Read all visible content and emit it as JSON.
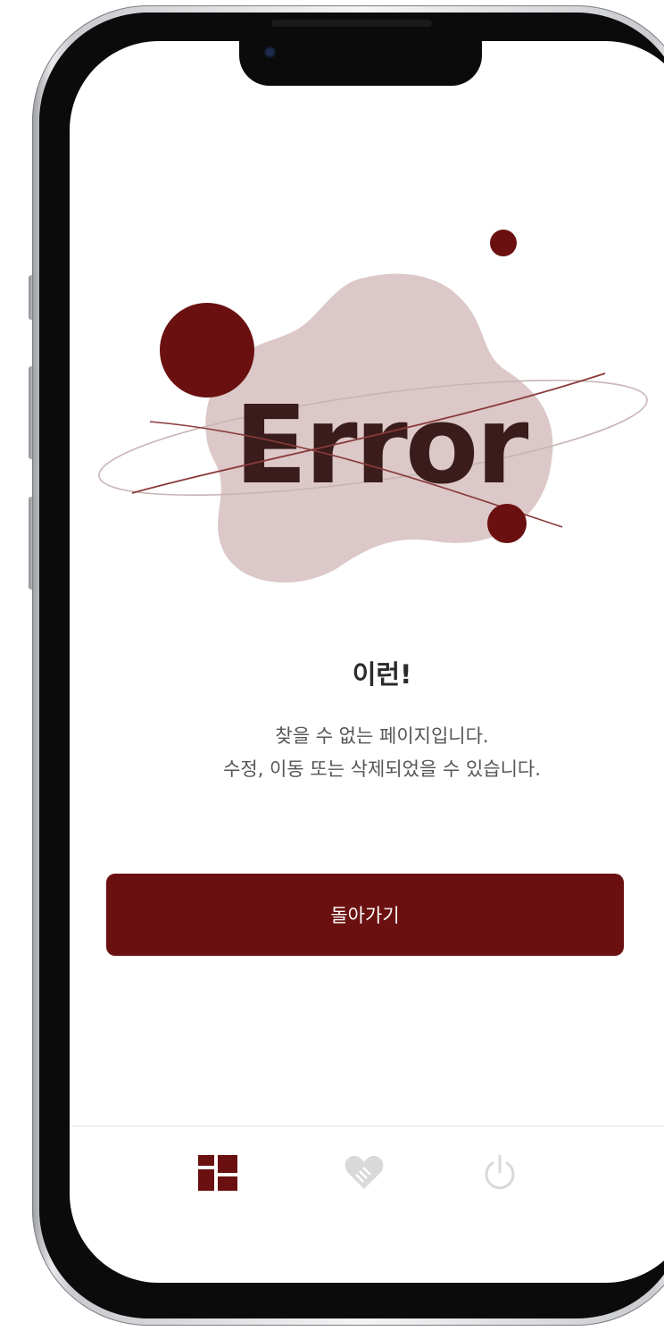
{
  "error_page": {
    "illustration_text": "Error",
    "title": "이런!",
    "description": [
      "찾을 수 없는 페이지입니다.",
      "수정, 이동 또는 삭제되었을 수 있습니다."
    ],
    "back_button_label": "돌아가기"
  },
  "tab_bar": {
    "items": [
      {
        "icon": "dashboard-grid-icon",
        "active": true
      },
      {
        "icon": "heart-handshake-icon",
        "active": false
      },
      {
        "icon": "power-icon",
        "active": false
      }
    ]
  },
  "colors": {
    "accent": "#6b1010",
    "blob": "#dcc8c8",
    "error_text": "#3a1c1c",
    "inactive_icon": "#d9d9d9"
  }
}
